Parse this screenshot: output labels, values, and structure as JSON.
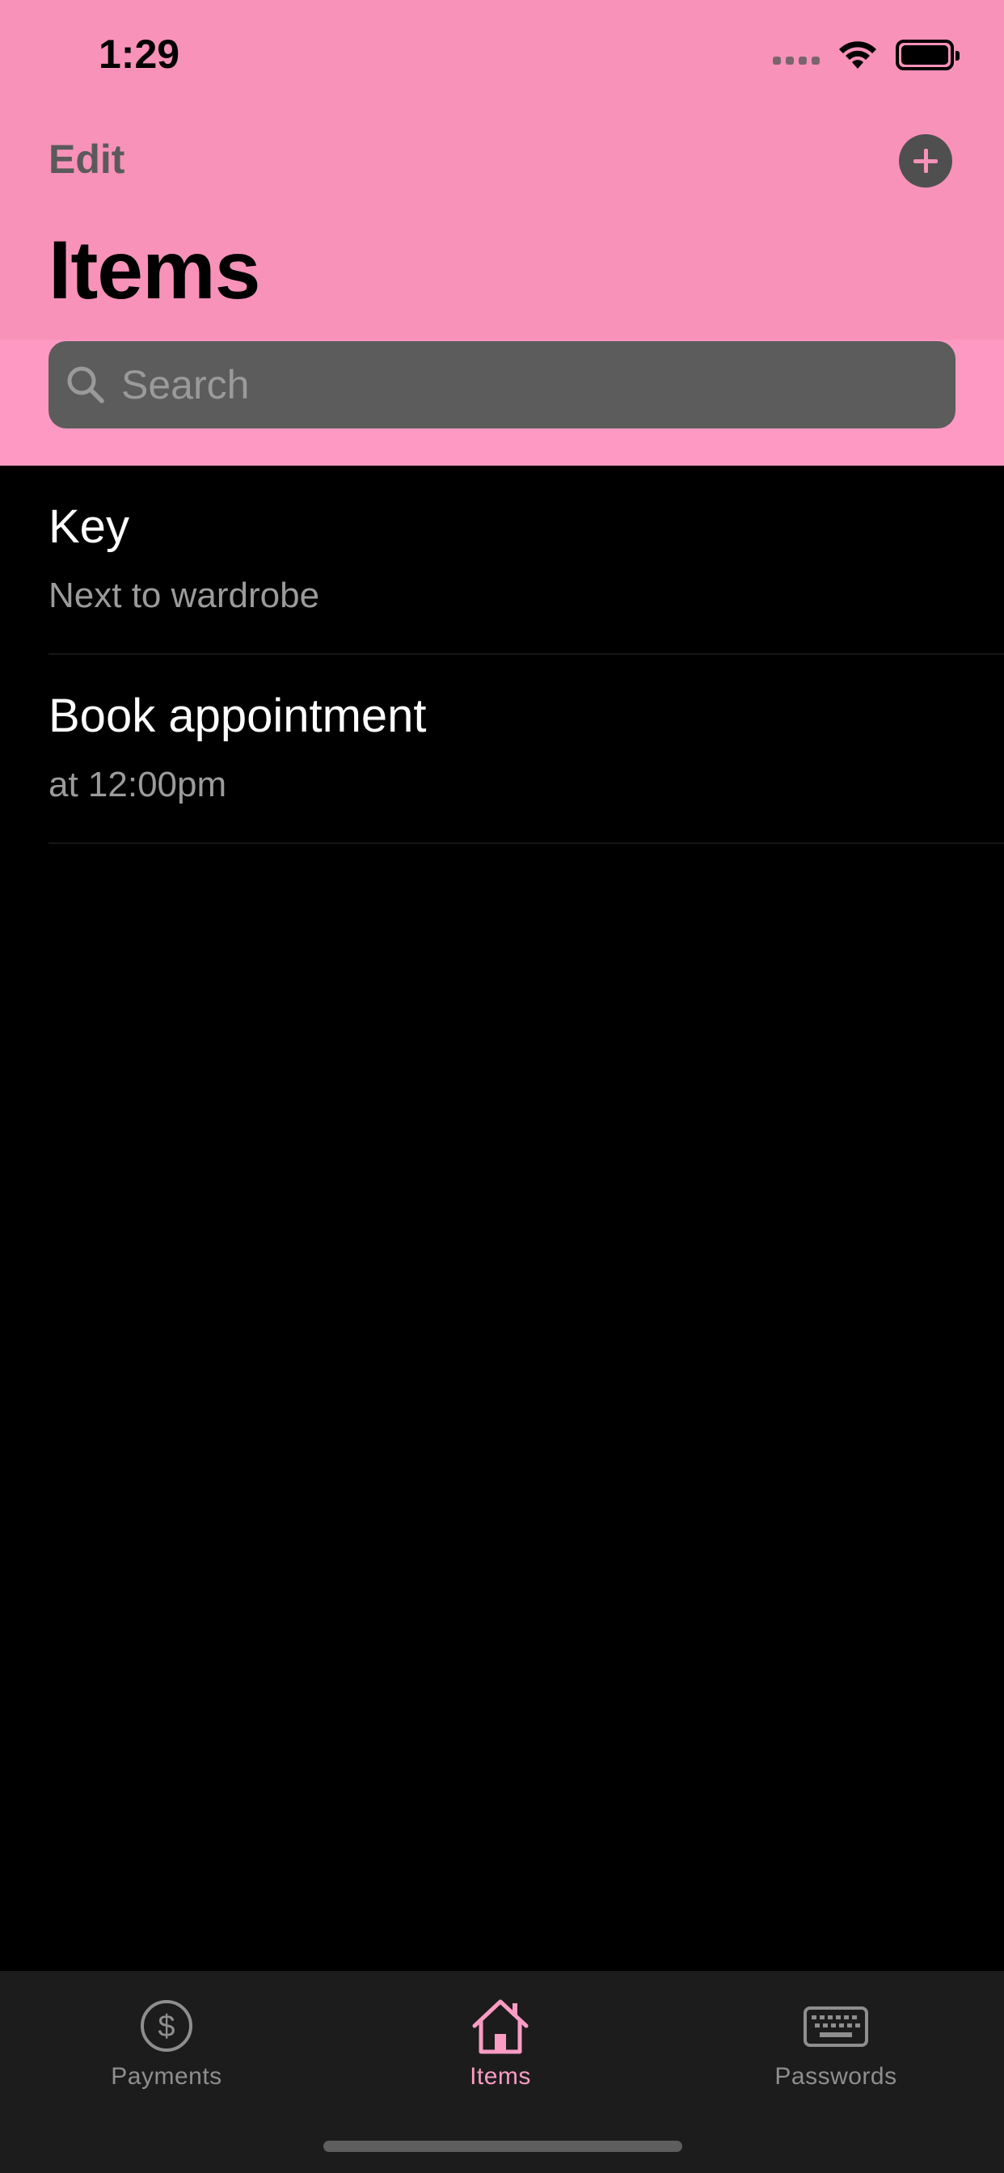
{
  "status_bar": {
    "time": "1:29"
  },
  "nav": {
    "edit_label": "Edit",
    "add_icon": "plus-circle-icon"
  },
  "page": {
    "title": "Items"
  },
  "search": {
    "placeholder": "Search",
    "value": ""
  },
  "list": [
    {
      "title": "Key",
      "subtitle": "Next to wardrobe"
    },
    {
      "title": "Book appointment",
      "subtitle": "at 12:00pm"
    }
  ],
  "tabs": [
    {
      "label": "Payments",
      "icon": "dollar-circle-icon",
      "active": false
    },
    {
      "label": "Items",
      "icon": "house-icon",
      "active": true
    },
    {
      "label": "Passwords",
      "icon": "keyboard-icon",
      "active": false
    }
  ],
  "colors": {
    "header_bg": "#F892B8",
    "header_lower_bg": "#FE99C3",
    "accent": "#FA9CC4",
    "search_bg": "#5C5C5C",
    "tabbar_bg": "#1C1C1C",
    "background": "#000000"
  }
}
